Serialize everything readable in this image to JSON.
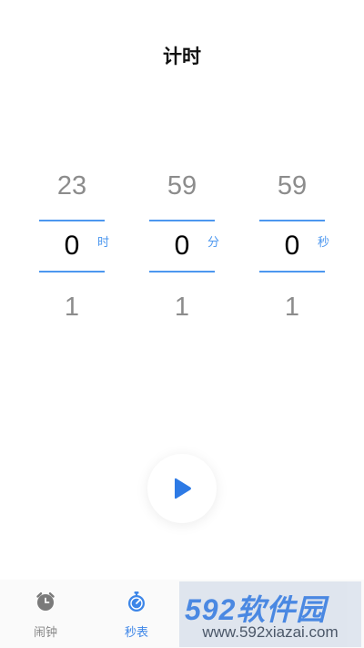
{
  "header": {
    "title": "计时"
  },
  "picker": {
    "hours": {
      "prev": "23",
      "current": "0",
      "next": "1",
      "unit": "时"
    },
    "minutes": {
      "prev": "59",
      "current": "0",
      "next": "1",
      "unit": "分"
    },
    "seconds": {
      "prev": "59",
      "current": "0",
      "next": "1",
      "unit": "秒"
    }
  },
  "controls": {
    "play_icon": "play-icon"
  },
  "tabbar": {
    "items": [
      {
        "label": "闹钟",
        "icon": "alarm-clock-icon",
        "active": false
      },
      {
        "label": "秒表",
        "icon": "stopwatch-icon",
        "active": true
      }
    ]
  },
  "watermark": {
    "brand": "592软件园",
    "url": "www.592xiazai.com"
  },
  "colors": {
    "accent": "#4c97ef",
    "play": "#2d7ae5",
    "inactive": "#888888"
  }
}
